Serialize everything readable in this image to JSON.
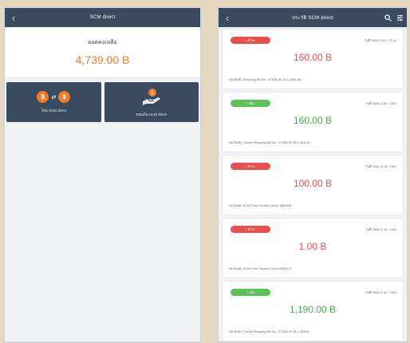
{
  "left": {
    "title": "SCM direct",
    "balance_label": "ยอดคงเหลือ",
    "balance_value": "4,739.00 B",
    "actions": [
      {
        "label": "โอน SCM direct",
        "icon": "transfer-coins-icon"
      },
      {
        "label": "ถอนเงิน SCM direct",
        "icon": "hand-money-icon"
      }
    ]
  },
  "right": {
    "title": "ประวัติ SCM direct",
    "transactions": [
      {
        "badge": "• ชำระ",
        "badge_color": "#e8504f",
        "date": "วันที่ 2566 12:51 / 21:14",
        "amount": "160.00 B",
        "amount_color": "#e8504f",
        "note": "หมายเหตุ: Shopping Bill No : 07105L/R-1R-1-3696-08"
      },
      {
        "badge": "+ เติม",
        "badge_color": "#5cc158",
        "date": "วันที่ 2566 12:51 / 1302",
        "amount": "160.00 B",
        "amount_color": "#4aad45",
        "note": "หมายเหตุ: Cancel Shopping Bill No : 07105L/R-1R-1-3549-B"
      },
      {
        "badge": "• ชำระ",
        "badge_color": "#e8504f",
        "date": "วันที่ 2566 12:16 / 1347",
        "amount": "100.00 B",
        "amount_color": "#e8504f",
        "note": "หมายเหตุ: SCM Point Transfer Out to 1001655"
      },
      {
        "badge": "• ชำระ",
        "badge_color": "#e8504f",
        "date": "วันที่ 2566 12:16 / 1316",
        "amount": "1.00 B",
        "amount_color": "#e8504f",
        "note": "หมายเหตุ: SCM Point Transfer Out to 2000174"
      },
      {
        "badge": "+ เติม",
        "badge_color": "#5cc158",
        "date": "วันที่ 2566 12:49 / 1553",
        "amount": "1,190.00 B",
        "amount_color": "#4aad45",
        "note": "หมายเหตุ: Cancel Shopping Bill No : 07105L/R-1R-1-3556Q"
      }
    ]
  }
}
